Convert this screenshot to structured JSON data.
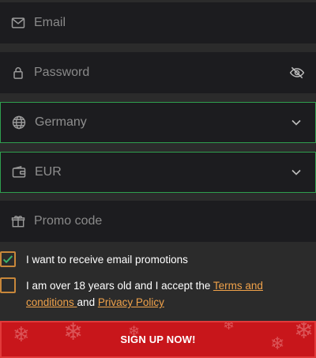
{
  "form": {
    "email": {
      "placeholder": "Email",
      "icon": "mail-icon"
    },
    "password": {
      "placeholder": "Password",
      "icon": "lock-icon",
      "toggle_icon": "eye-off-icon"
    },
    "country": {
      "value": "Germany",
      "icon": "globe-icon"
    },
    "currency": {
      "value": "EUR",
      "icon": "wallet-icon"
    },
    "promo": {
      "placeholder": "Promo code",
      "icon": "gift-icon"
    }
  },
  "checks": {
    "promotions": {
      "label": "I want to receive email promotions",
      "checked": true
    },
    "terms": {
      "prefix": "I am over 18 years old and I accept the ",
      "terms_link": "Terms and conditions ",
      "middle": "and ",
      "privacy_link": "Privacy Policy",
      "checked": false
    }
  },
  "submit": {
    "label": "SIGN UP NOW!"
  },
  "colors": {
    "accent_green": "#2f9e4e",
    "link_orange": "#f0a24a",
    "checkbox_border": "#c8873a",
    "button_red": "#c8161b"
  }
}
